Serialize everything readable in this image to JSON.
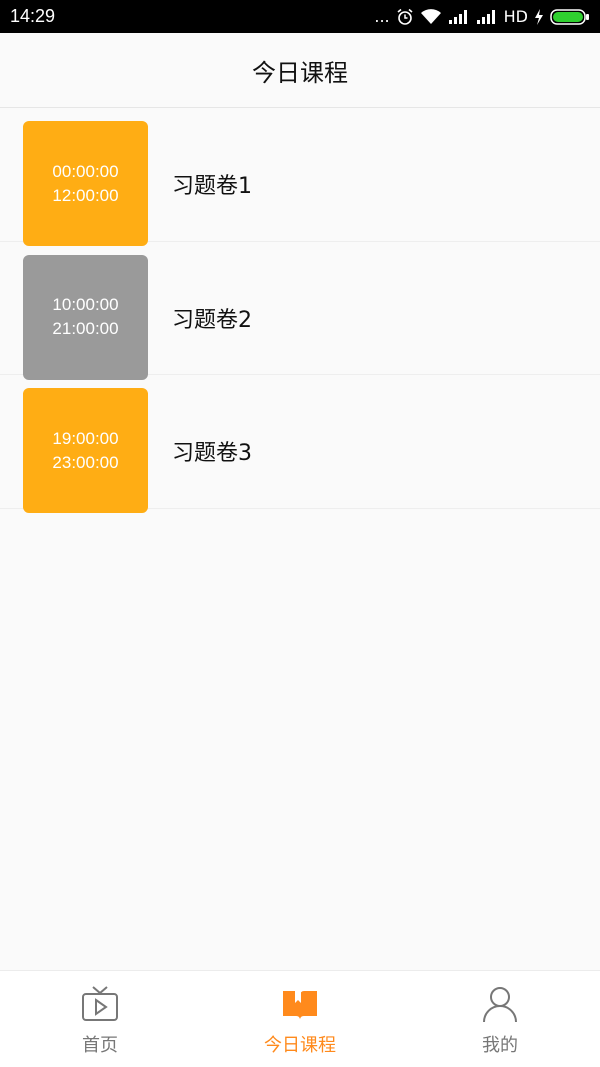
{
  "status_bar": {
    "time": "14:29",
    "dots": "...",
    "network": "HD",
    "battery_color": "#2fd02f"
  },
  "header": {
    "title": "今日课程"
  },
  "courses": [
    {
      "start": "00:00:00",
      "end": "12:00:00",
      "name": "习题卷1",
      "color": "#ffad14"
    },
    {
      "start": "10:00:00",
      "end": "21:00:00",
      "name": "习题卷2",
      "color": "#9a9a9a"
    },
    {
      "start": "19:00:00",
      "end": "23:00:00",
      "name": "习题卷3",
      "color": "#ffad14"
    }
  ],
  "tab_bar": {
    "active_color": "#ff8a1c",
    "inactive_color": "#777777",
    "tabs": [
      {
        "label": "首页",
        "icon": "tv-icon",
        "active": false
      },
      {
        "label": "今日课程",
        "icon": "book-icon",
        "active": true
      },
      {
        "label": "我的",
        "icon": "user-icon",
        "active": false
      }
    ]
  }
}
